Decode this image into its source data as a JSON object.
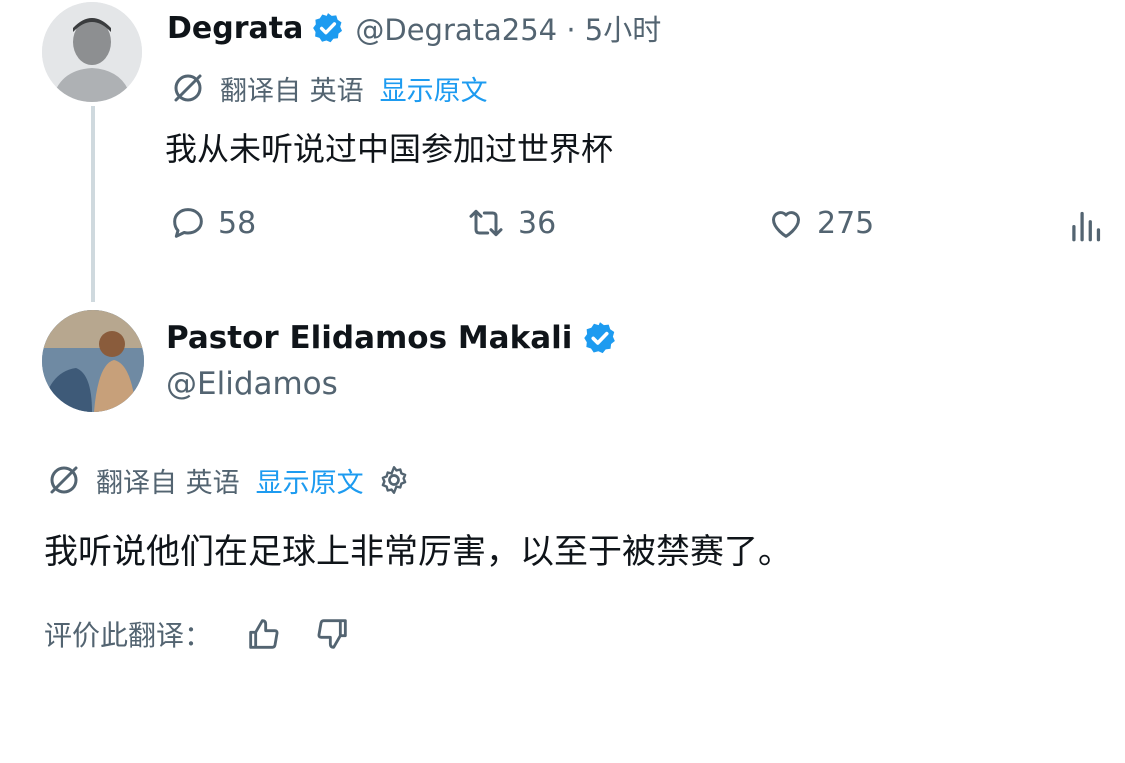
{
  "tweet1": {
    "name": "Degrata",
    "handle_time": "@Degrata254 · 5小时",
    "translated_from": "翻译自 英语",
    "show_original": "显示原文",
    "text": "我从未听说过中国参加过世界杯",
    "replies": "58",
    "retweets": "36",
    "likes": "275"
  },
  "tweet2": {
    "name": "Pastor Elidamos Makali",
    "handle": "@Elidamos",
    "translated_from": "翻译自 英语",
    "show_original": "显示原文",
    "text": "我听说他们在足球上非常厉害，以至于被禁赛了。",
    "rate_translation": "评价此翻译："
  },
  "colors": {
    "verified": "#1d9bf0",
    "link": "#1d9bf0",
    "secondary_text": "#536471"
  },
  "icons": [
    "verified-badge-icon",
    "translate-icon",
    "reply-icon",
    "retweet-icon",
    "like-icon",
    "views-icon",
    "gear-icon",
    "thumbs-up-icon",
    "thumbs-down-icon"
  ]
}
